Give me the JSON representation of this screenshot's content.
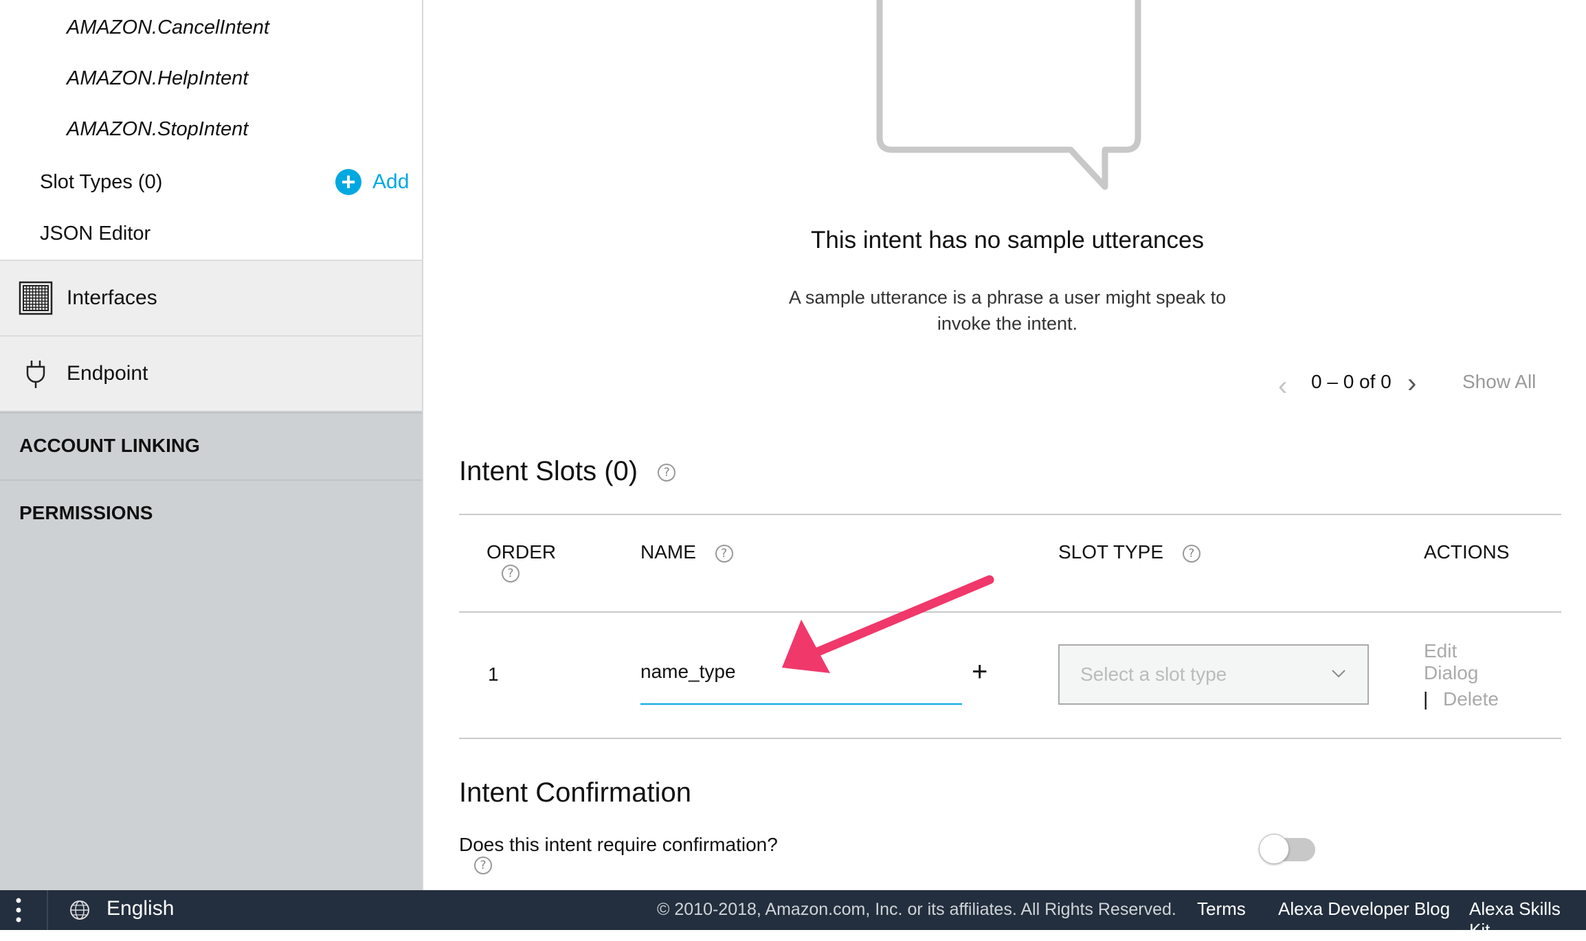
{
  "sidebar": {
    "intents": [
      "AMAZON.CancelIntent",
      "AMAZON.HelpIntent",
      "AMAZON.StopIntent"
    ],
    "slot_types_label": "Slot Types (0)",
    "add_label": "Add",
    "json_editor_label": "JSON Editor",
    "interfaces_label": "Interfaces",
    "endpoint_label": "Endpoint",
    "account_linking_label": "ACCOUNT LINKING",
    "permissions_label": "PERMISSIONS"
  },
  "utterances": {
    "empty_title": "This intent has no sample utterances",
    "empty_desc_line1": "A sample utterance is a phrase a user might speak to",
    "empty_desc_line2": "invoke the intent.",
    "pager_text": "0 – 0 of 0",
    "show_all": "Show All"
  },
  "slots": {
    "title": "Intent Slots (0)",
    "columns": {
      "order": "ORDER",
      "name": "NAME",
      "slot_type": "SLOT TYPE",
      "actions": "ACTIONS"
    },
    "help_glyph": "?",
    "rows": [
      {
        "order": "1",
        "name": "name_type",
        "slot_type_placeholder": "Select a slot type",
        "edit_dialog_line1": "Edit",
        "edit_dialog_line2": "Dialog",
        "separator": "|",
        "delete": "Delete"
      }
    ],
    "add_glyph": "+"
  },
  "confirmation": {
    "title": "Intent Confirmation",
    "question": "Does this intent require confirmation?",
    "enabled": false
  },
  "footer": {
    "language": "English",
    "copyright": "© 2010-2018, Amazon.com, Inc. or its affiliates. All Rights Reserved.",
    "links": [
      "Terms",
      "Alexa Developer Blog",
      "Alexa Skills Kit"
    ]
  },
  "colors": {
    "accent": "#00a8e1",
    "footer_bg": "#232f3e",
    "annotation_arrow": "#f0386b",
    "sidebar_gray": "#ced1d3"
  }
}
